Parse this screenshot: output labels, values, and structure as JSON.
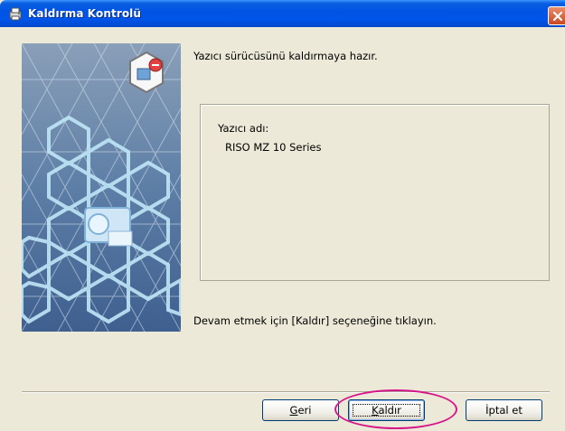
{
  "window": {
    "title": "Kaldırma Kontrolü",
    "title_icon": "printer-wizard-icon"
  },
  "main": {
    "heading": "Yazıcı sürücüsünü kaldırmaya hazır.",
    "printer_label": "Yazıcı adı:",
    "printer_name": "RISO MZ 10 Series",
    "instruction": "Devam etmek için [Kaldır] seçeneğine tıklayın."
  },
  "buttons": {
    "back_label_mnemonic": "G",
    "back_label_rest": "eri",
    "remove_label_mnemonic": "K",
    "remove_label_rest": "aldır",
    "cancel_label": "İptal et"
  },
  "colors": {
    "titlebar": "#0054e3",
    "highlight": "#d6178a",
    "dialog_bg": "#ece9d8"
  }
}
